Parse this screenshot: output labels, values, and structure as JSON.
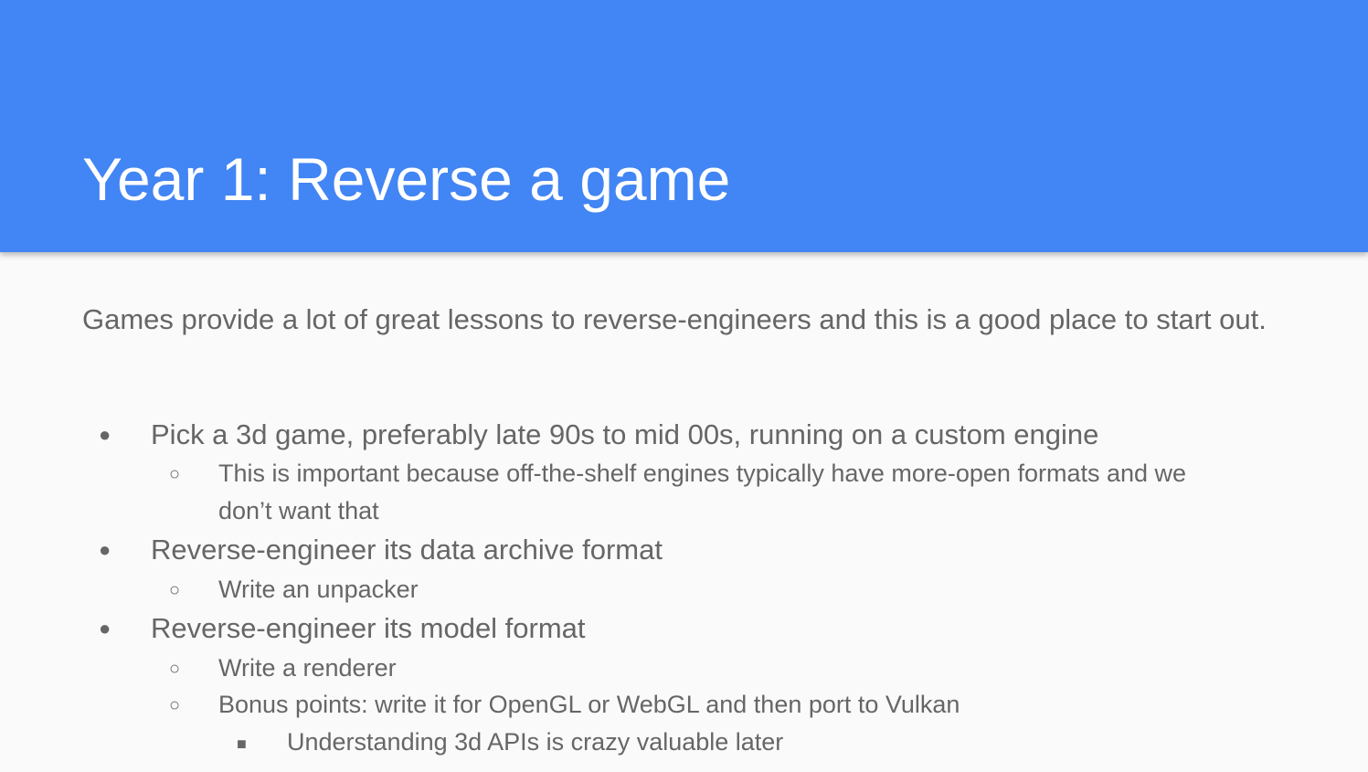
{
  "slide": {
    "title": "Year 1: Reverse a game",
    "intro": "Games provide a lot of great lessons to reverse-engineers and this is a good place to start out.",
    "colors": {
      "header_bg": "#4285f4",
      "title_text": "#ffffff",
      "body_text": "#666666",
      "background": "#fafafa"
    },
    "bullets": [
      {
        "text": "Pick a 3d game, preferably late 90s to mid 00s, running on a custom engine",
        "sub": [
          {
            "text": "This is important because off-the-shelf engines typically have more-open formats and we",
            "text_cont": "don’t want that"
          }
        ]
      },
      {
        "text": "Reverse-engineer its data archive format",
        "sub": [
          {
            "text": "Write an unpacker"
          }
        ]
      },
      {
        "text": "Reverse-engineer its model format",
        "sub": [
          {
            "text": "Write a renderer"
          },
          {
            "text": "Bonus points: write it for OpenGL or WebGL and then port to Vulkan",
            "sub": [
              {
                "text": "Understanding 3d APIs is crazy valuable later"
              }
            ]
          }
        ]
      }
    ],
    "markers": {
      "level1": "●",
      "level2": "○",
      "level3": "■"
    }
  }
}
